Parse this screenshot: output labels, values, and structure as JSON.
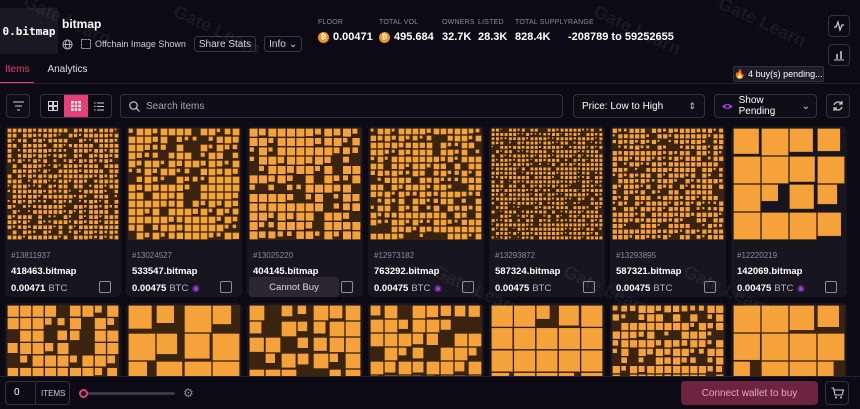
{
  "collection": {
    "logo_text": "0.bitmap",
    "name": "bitmap",
    "offchain_label": "Offchain Image Shown",
    "share_label": "Share Stats",
    "info_label": "Info"
  },
  "stats": [
    {
      "label": "FLOOR",
      "value": "0.00471",
      "btc": true
    },
    {
      "label": "TOTAL VOL",
      "value": "495.684",
      "btc": true
    },
    {
      "label": "OWNERS",
      "value": "32.7K",
      "btc": false
    },
    {
      "label": "LISTED",
      "value": "28.3K",
      "btc": false
    },
    {
      "label": "TOTAL SUPPLY",
      "value": "828.4K",
      "btc": false
    },
    {
      "label": "RANGE",
      "value": "-208789 to 59252655",
      "btc": false
    }
  ],
  "tabs": [
    {
      "label": "Items",
      "active": true
    },
    {
      "label": "Analytics",
      "active": false
    }
  ],
  "pending_banner": "🔥 4 buy(s) pending...",
  "search": {
    "placeholder": "Search items"
  },
  "sort": {
    "value": "Price: Low to High"
  },
  "show_pending": {
    "label": "Show Pending"
  },
  "cards": [
    {
      "id": "#13811937",
      "name": "418463.bitmap",
      "price": "0.00471",
      "unit": "BTC",
      "pending": false,
      "cannot_buy": false
    },
    {
      "id": "#13024527",
      "name": "533547.bitmap",
      "price": "0.00475",
      "unit": "BTC",
      "pending": true,
      "cannot_buy": false
    },
    {
      "id": "#13025220",
      "name": "404145.bitmap",
      "price": "",
      "unit": "",
      "pending": false,
      "cannot_buy": true
    },
    {
      "id": "#12973182",
      "name": "763292.bitmap",
      "price": "0.00475",
      "unit": "BTC",
      "pending": true,
      "cannot_buy": false
    },
    {
      "id": "#13293872",
      "name": "587324.bitmap",
      "price": "0.00475",
      "unit": "BTC",
      "pending": false,
      "cannot_buy": false
    },
    {
      "id": "#13293895",
      "name": "587321.bitmap",
      "price": "0.00475",
      "unit": "BTC",
      "pending": false,
      "cannot_buy": false
    },
    {
      "id": "#12220219",
      "name": "142069.bitmap",
      "price": "0.00475",
      "unit": "BTC",
      "pending": true,
      "cannot_buy": false
    }
  ],
  "cannot_buy_label": "Cannot Buy",
  "footer": {
    "quantity": "0",
    "items_label": "ITEMS",
    "connect_label": "Connect wallet to buy"
  },
  "watermark": "Gate Learn",
  "colors": {
    "accent": "#e83e77",
    "bitmap_orange": "#f5a23a",
    "btc": "#f7931a",
    "pending_eye": "#a43ee0"
  }
}
